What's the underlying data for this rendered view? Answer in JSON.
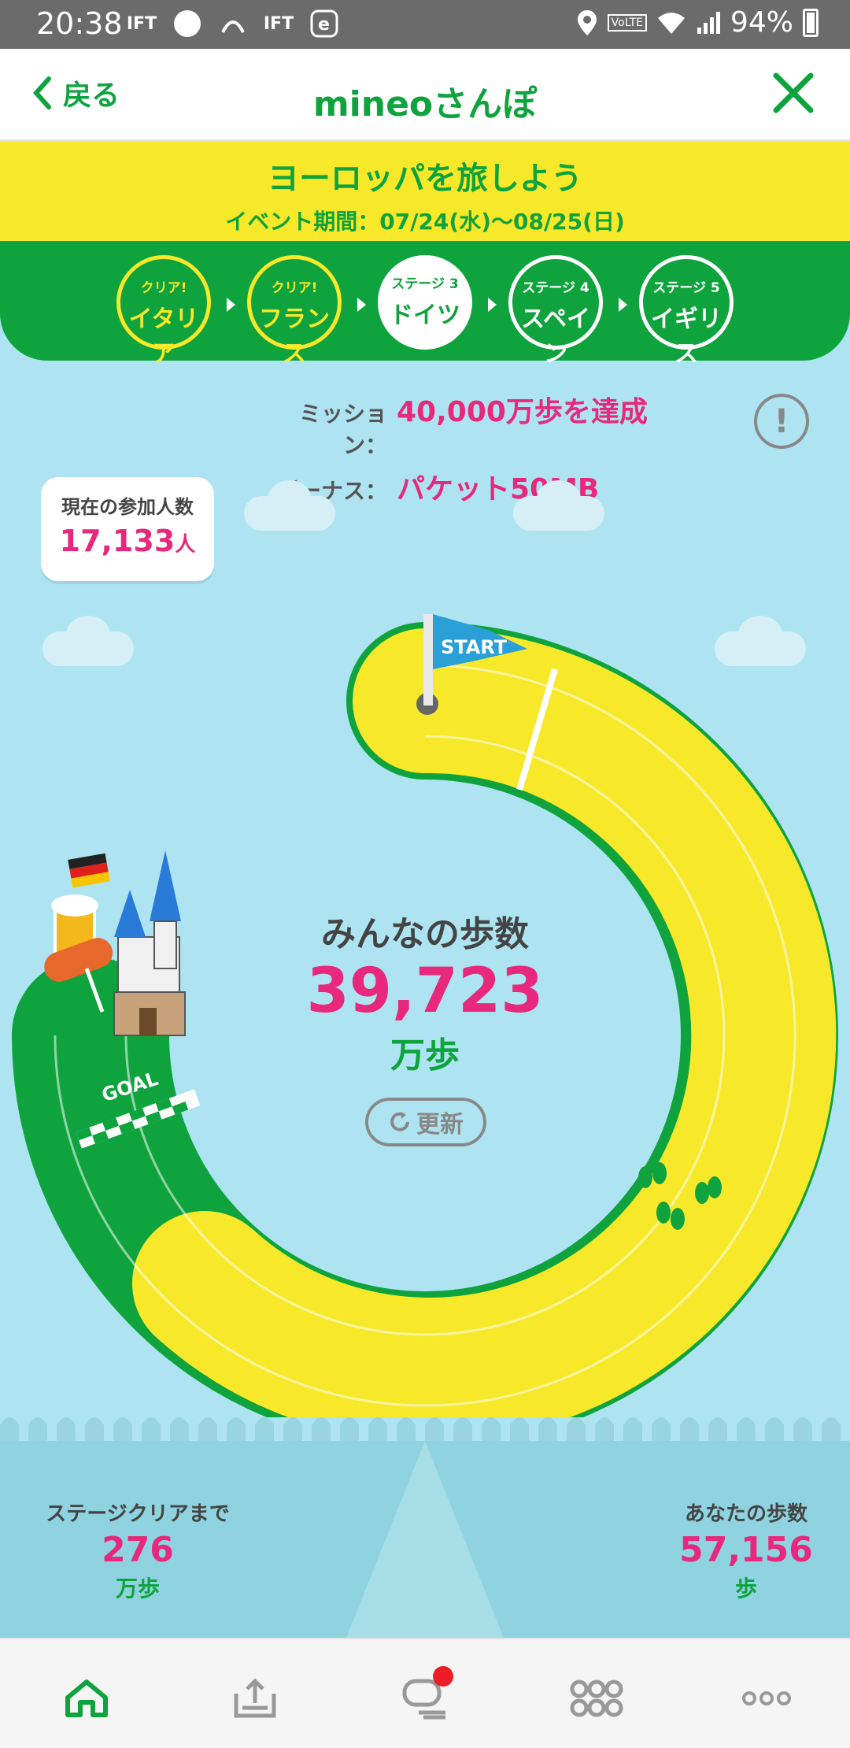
{
  "status_bar": {
    "time": "20:38",
    "notification_icons": [
      "IFTTT",
      "カロリーアプリ",
      "ON",
      "IFTTT",
      "e"
    ],
    "volte": "VoLTE",
    "battery": "94%"
  },
  "header": {
    "back_label": "戻る",
    "title": "mineoさんぽ",
    "close_icon": "close-icon"
  },
  "event": {
    "title": "ヨーロッパを旅しよう",
    "period": "イベント期間：07/24(水)〜08/25(日)"
  },
  "stages": [
    {
      "small": "クリア!",
      "name": "イタリア",
      "state": "cleared"
    },
    {
      "small": "クリア!",
      "name": "フランス",
      "state": "cleared"
    },
    {
      "small": "ステージ 3",
      "name": "ドイツ",
      "state": "current"
    },
    {
      "small": "ステージ 4",
      "name": "スペイン",
      "state": "locked"
    },
    {
      "small": "ステージ 5",
      "name": "イギリス",
      "state": "locked"
    }
  ],
  "mission": {
    "mission_label": "ミッション：",
    "mission_value": "40,000万歩を達成",
    "bonus_label": "ボーナス：",
    "bonus_value": "パケット50MB"
  },
  "participants": {
    "label": "現在の参加人数",
    "value": "17,133",
    "unit": "人"
  },
  "track": {
    "start_label": "START",
    "goal_label": "GOAL",
    "progress_fraction": 0.993
  },
  "total": {
    "label": "みんなの歩数",
    "value": "39,723",
    "unit": "万歩",
    "refresh_label": "更新"
  },
  "stats": {
    "remaining_label": "ステージクリアまで",
    "remaining_value": "276",
    "remaining_unit": "万歩",
    "mine_label": "あなたの歩数",
    "mine_value": "57,156",
    "mine_unit": "歩"
  },
  "nav": [
    "home-icon",
    "upload-icon",
    "chat-icon",
    "community-icon",
    "more-icon"
  ],
  "colors": {
    "green": "#0ea33d",
    "yellow": "#f7e92a",
    "pink": "#e7287c",
    "sky": "#aee4f1"
  }
}
